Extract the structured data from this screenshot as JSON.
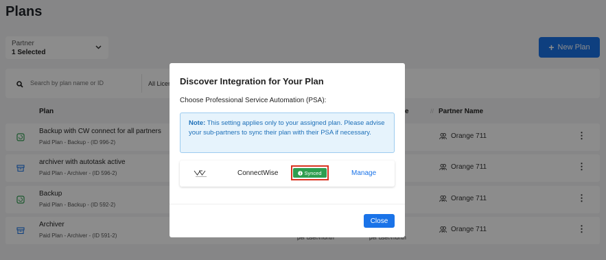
{
  "page": {
    "title": "Plans"
  },
  "filters": {
    "partner_label": "Partner",
    "partner_value": "1 Selected"
  },
  "toolbar": {
    "new_plan_label": "New Plan"
  },
  "search": {
    "placeholder": "Search by plan name or ID",
    "license_filter_label": "All Licen"
  },
  "table": {
    "headers": {
      "plan": "Plan",
      "partially_hidden": "e",
      "partner_name": "Partner Name"
    },
    "rows": [
      {
        "name": "Backup with CW connect for all partners",
        "sub": "Paid Plan - Backup - (ID 996-2)",
        "partner": "Orange 711",
        "icon": "backup-icon",
        "ghost_left": "",
        "ghost_right": ""
      },
      {
        "name": "archiver with autotask active",
        "sub": "Paid Plan - Archiver - (ID 596-2)",
        "partner": "Orange 711",
        "icon": "archiver-icon",
        "ghost_left": "",
        "ghost_right": ""
      },
      {
        "name": "Backup",
        "sub": "Paid Plan - Backup - (ID 592-2)",
        "partner": "Orange 711",
        "icon": "backup-icon",
        "ghost_left": "",
        "ghost_right": ""
      },
      {
        "name": "Archiver",
        "sub": "Paid Plan - Archiver - (ID 591-2)",
        "partner": "Orange 711",
        "icon": "archiver-icon",
        "ghost_left": "per user/month",
        "ghost_right": "per user/month"
      }
    ]
  },
  "modal": {
    "title": "Discover Integration for Your Plan",
    "subtitle": "Choose Professional Service Automation (PSA):",
    "note_bold": "Note:",
    "note_text": " This setting applies only to your assigned plan. Please advise your sub-partners to sync their plan with their PSA if necessary.",
    "psa": {
      "name": "ConnectWise",
      "status": "Synced",
      "action": "Manage",
      "logo": "connectwise-logo"
    },
    "close_label": "Close"
  },
  "colors": {
    "primary": "#1a73e8",
    "synced": "#2e9e4f",
    "highlight": "#d9321f",
    "note_bg": "#e6f3fc",
    "note_text": "#1d6fb8"
  }
}
